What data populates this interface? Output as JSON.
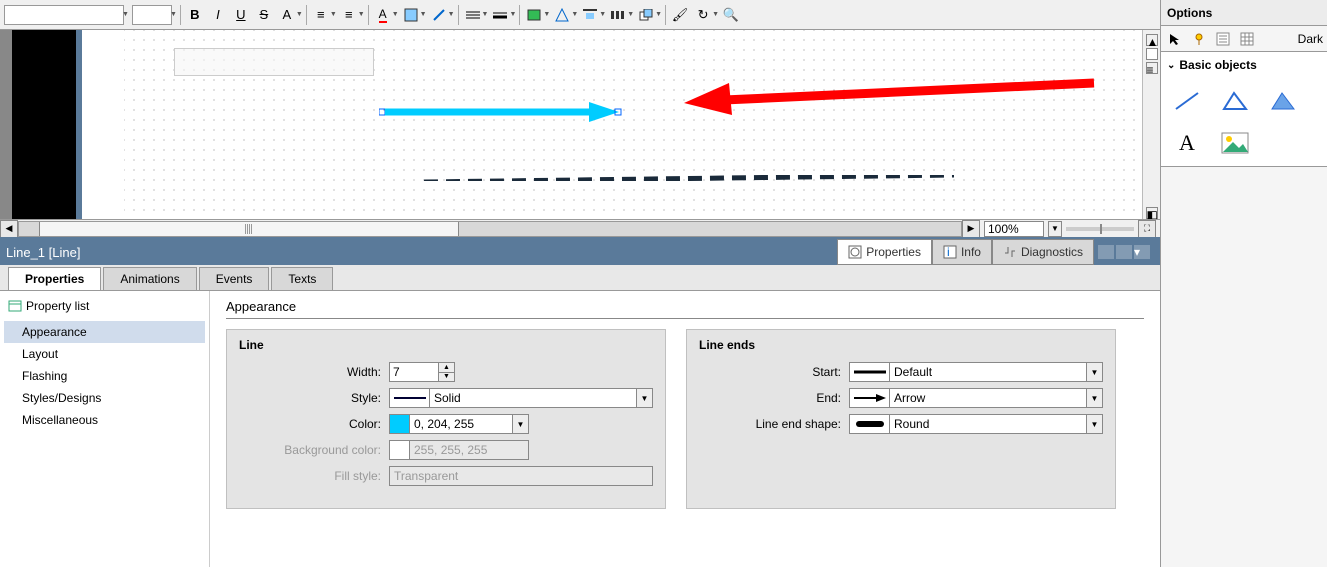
{
  "toolbar": {
    "font": "",
    "size": "",
    "bold": "B",
    "italic": "I",
    "underline": "U",
    "strike": "S",
    "fontCase": "A"
  },
  "zoom": {
    "value": "100%"
  },
  "inspector": {
    "title": "Line_1 [Line]",
    "rightTabs": {
      "properties": "Properties",
      "info": "Info",
      "diagnostics": "Diagnostics"
    },
    "subTabs": {
      "properties": "Properties",
      "animations": "Animations",
      "events": "Events",
      "texts": "Texts"
    },
    "propListTitle": "Property list",
    "propList": [
      "Appearance",
      "Layout",
      "Flashing",
      "Styles/Designs",
      "Miscellaneous"
    ],
    "section": "Appearance",
    "groupLine": "Line",
    "groupEnds": "Line ends",
    "labels": {
      "width": "Width:",
      "style": "Style:",
      "color": "Color:",
      "bgcolor": "Background color:",
      "fill": "Fill style:",
      "start": "Start:",
      "end": "End:",
      "shape": "Line end shape:"
    },
    "values": {
      "width": "7",
      "style": "Solid",
      "color": "0, 204, 255",
      "bgcolor": "255, 255, 255",
      "fill": "Transparent",
      "start": "Default",
      "end": "Arrow",
      "shape": "Round"
    },
    "colors": {
      "line": "#00ccff",
      "bg": "#ffffff"
    }
  },
  "rightPanel": {
    "options": "Options",
    "dark": "Dark",
    "basicObjects": "Basic objects",
    "textTool": "A"
  }
}
